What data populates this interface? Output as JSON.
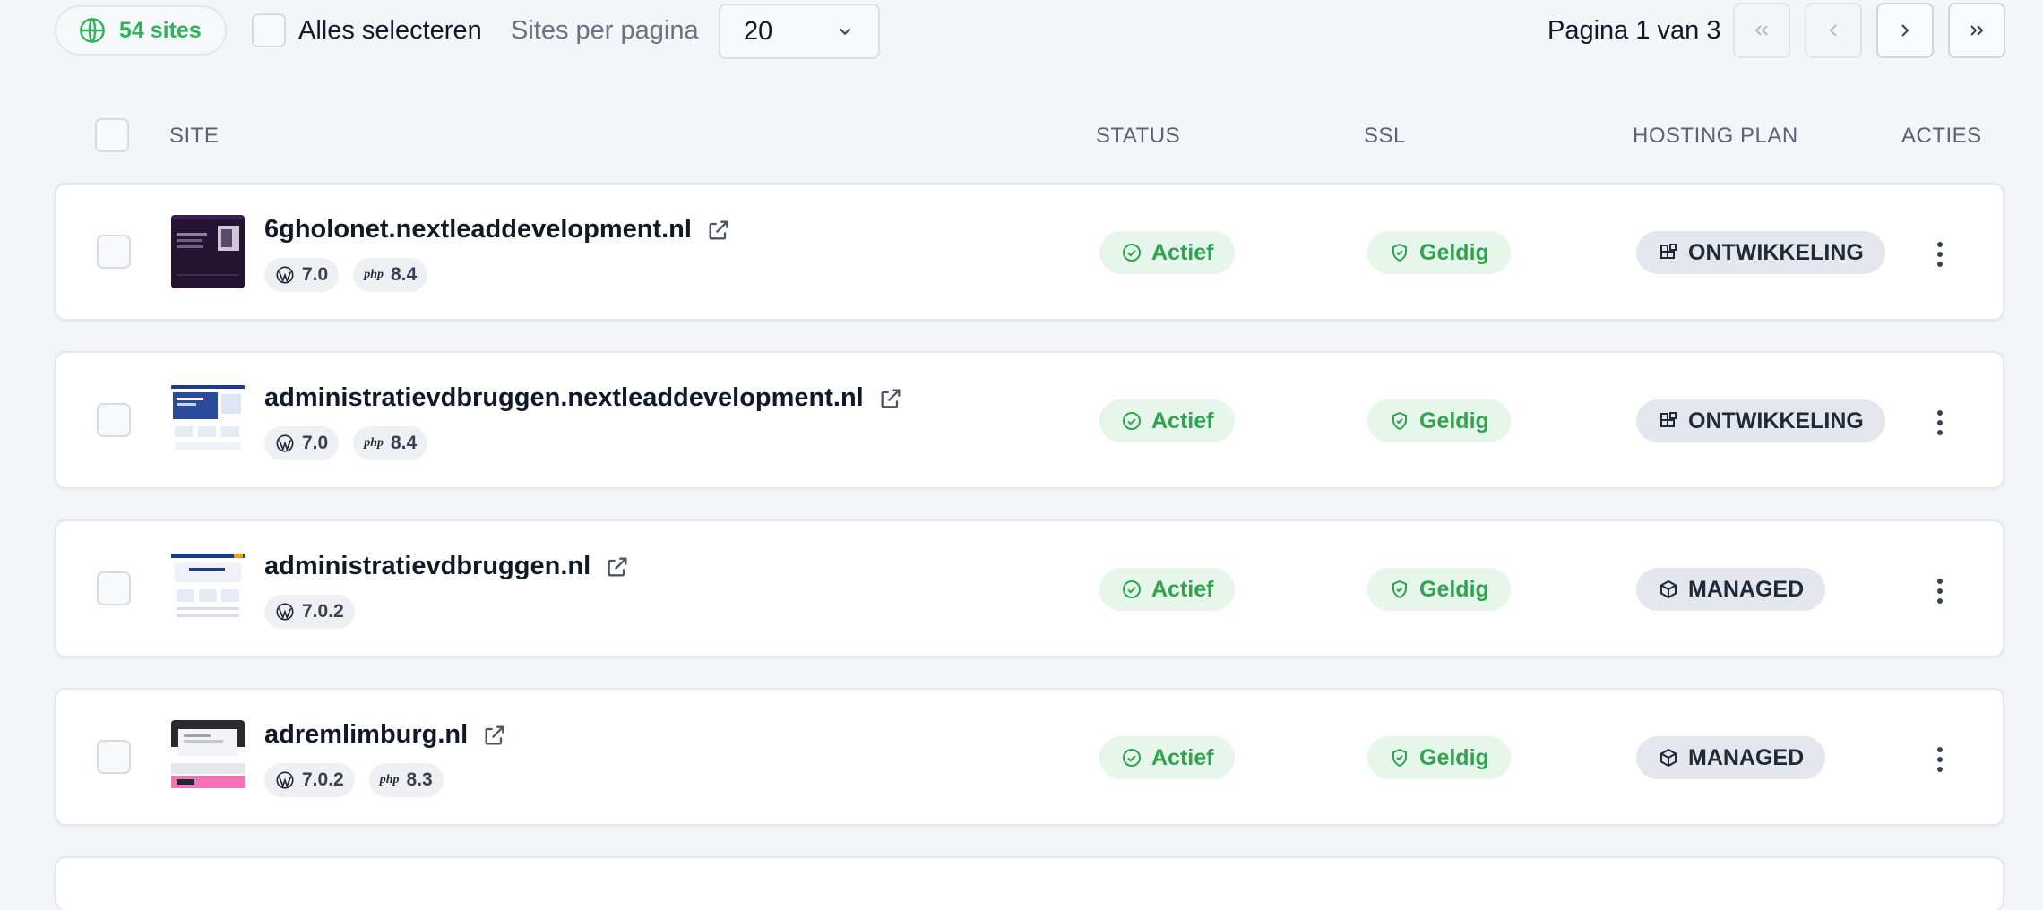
{
  "toolbar": {
    "sites_count": "54 sites",
    "select_all_label": "Alles selecteren",
    "per_page_label": "Sites per pagina",
    "per_page_value": "20",
    "page_label": "Pagina 1 van 3",
    "icons": {
      "count": "globe-icon",
      "dropdown": "chevron-down-icon",
      "first": "chevrons-left-icon",
      "prev": "chevron-left-icon",
      "next": "chevron-right-icon",
      "last": "chevrons-right-icon"
    }
  },
  "table": {
    "headers": {
      "site": "SITE",
      "status": "STATUS",
      "ssl": "SSL",
      "hosting_plan": "HOSTING PLAN",
      "actions": "ACTIES"
    },
    "rows": [
      {
        "name": "6gholonet.nextleaddevelopment.nl",
        "wp": "7.0",
        "php": "8.4",
        "php_mark": "php",
        "status": "Actief",
        "ssl": "Geldig",
        "plan": "ONTWIKKELING",
        "plan_icon": "blocks-icon"
      },
      {
        "name": "administratievdbruggen.nextleaddevelopment.nl",
        "wp": "7.0",
        "php": "8.4",
        "php_mark": "php",
        "status": "Actief",
        "ssl": "Geldig",
        "plan": "ONTWIKKELING",
        "plan_icon": "blocks-icon"
      },
      {
        "name": "administratievdbruggen.nl",
        "wp": "7.0.2",
        "status": "Actief",
        "ssl": "Geldig",
        "plan": "MANAGED",
        "plan_icon": "box-icon"
      },
      {
        "name": "adremlimburg.nl",
        "wp": "7.0.2",
        "php": "8.3",
        "php_mark": "php",
        "status": "Actief",
        "ssl": "Geldig",
        "plan": "MANAGED",
        "plan_icon": "box-icon"
      }
    ]
  },
  "colors": {
    "accent_green": "#2fa350",
    "green_bg": "#e6f6ea",
    "plan_bg": "#e4e8ee",
    "page_bg": "#f3f5f8"
  }
}
